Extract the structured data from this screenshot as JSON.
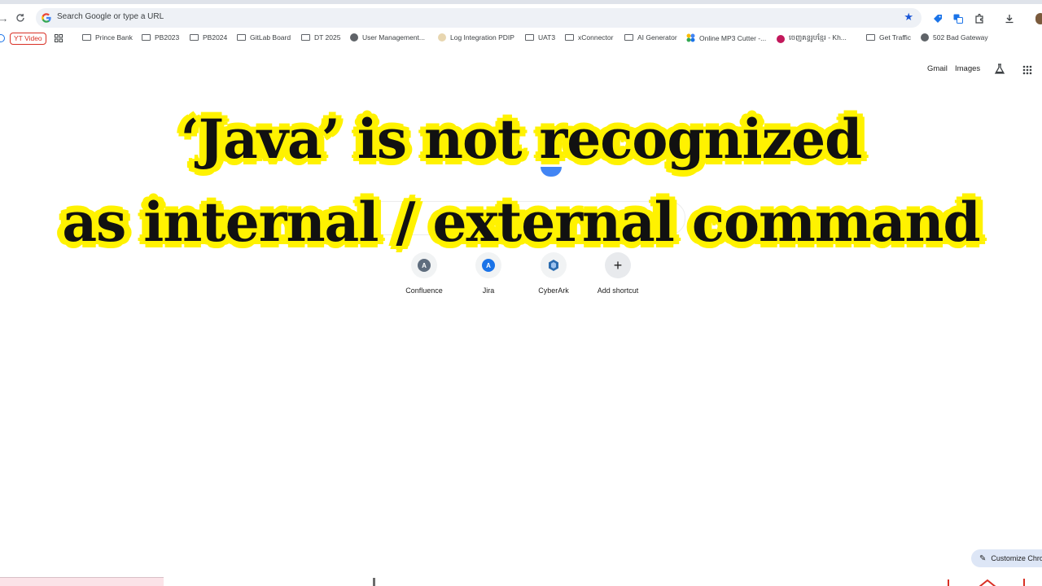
{
  "browser": {
    "omnibox_placeholder": "Search Google or type a URL"
  },
  "bookmarks": [
    {
      "label": "YT Video",
      "type": "badge"
    },
    {
      "label": "Prince Bank",
      "type": "folder"
    },
    {
      "label": "PB2023",
      "type": "folder"
    },
    {
      "label": "PB2024",
      "type": "folder"
    },
    {
      "label": "GitLab Board",
      "type": "folder"
    },
    {
      "label": "DT 2025",
      "type": "folder"
    },
    {
      "label": "User Management...",
      "type": "site"
    },
    {
      "label": "Log Integration PDIP",
      "type": "site"
    },
    {
      "label": "UAT3",
      "type": "folder"
    },
    {
      "label": "xConnector",
      "type": "folder"
    },
    {
      "label": "AI Generator",
      "type": "folder"
    },
    {
      "label": "Online MP3 Cutter -...",
      "type": "site"
    },
    {
      "label": "ចេញគន្ធរូបខ្មែរ - Kh...",
      "type": "site"
    },
    {
      "label": "Get Traffic",
      "type": "folder"
    },
    {
      "label": "502 Bad Gateway",
      "type": "site"
    }
  ],
  "header_links": {
    "gmail": "Gmail",
    "images": "Images"
  },
  "overlay": {
    "line1": "‘Java’ is not recognized",
    "line2": "as internal / external command"
  },
  "shortcuts": [
    {
      "label": "Confluence",
      "initial": "A",
      "color": "#5f6d7e"
    },
    {
      "label": "Jira",
      "initial": "A",
      "color": "#1a73e8"
    },
    {
      "label": "CyberArk",
      "initial": "",
      "color": "#2b6cb0"
    },
    {
      "label": "Add shortcut",
      "initial": "+",
      "color": "#1f1f1f"
    }
  ],
  "customize_button": "Customize Chrome",
  "colors": {
    "highlight": "#fff200",
    "accent_blue": "#1a56d6"
  }
}
